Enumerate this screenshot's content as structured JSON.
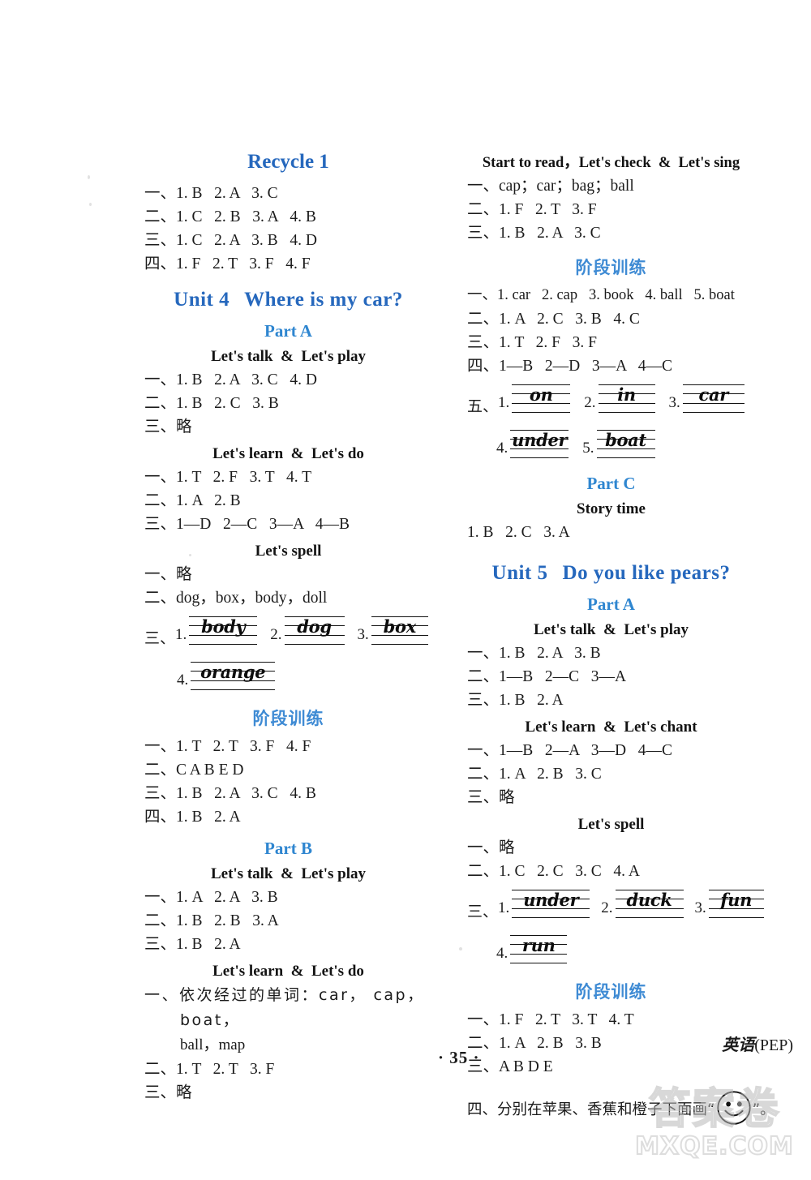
{
  "page": {
    "number": "· 35 ·",
    "book_label_cn": "英语",
    "book_label_en": "(PEP)"
  },
  "watermark": {
    "cn": "答案卷",
    "en": "MXQE.COM"
  },
  "left_column": {
    "recycle_heading": "Recycle 1",
    "recycle_answers": [
      "一、1. B   2. A   3. C",
      "二、1. C   2. B   3. A   4. B",
      "三、1. C   2. A   3. B   4. D",
      "四、1. F   2. T   3. F   4. F"
    ],
    "unit_label": "Unit 4",
    "unit_title": "Where is my car?",
    "part_a": "Part A",
    "sec_talk_play": "Let's talk  &  Let's play",
    "talk_play_answers": [
      "一、1. B   2. A   3. C   4. D",
      "二、1. B   2. C   3. B",
      "三、略"
    ],
    "sec_learn_do": "Let's learn  &  Let's do",
    "learn_do_answers": [
      "一、1. T   2. F   3. T   4. T",
      "二、1. A   2. B",
      "三、1—D   2—C   3—A   4—B"
    ],
    "sec_spell": "Let's spell",
    "spell_answers": [
      "一、略",
      "二、dog，box，body，doll"
    ],
    "spell_handwriting_label": "三、",
    "spell_handwriting": [
      {
        "num": "1.",
        "word": "body"
      },
      {
        "num": "2.",
        "word": "dog"
      },
      {
        "num": "3.",
        "word": "box"
      },
      {
        "num": "4.",
        "word": "orange"
      }
    ],
    "stage_training": "阶段训练",
    "stage_answers": [
      "一、1. T   2. T   3. F   4. F",
      "二、C A B E D",
      "三、1. B   2. A   3. C   4. B",
      "四、1. B   2. A"
    ],
    "part_b": "Part B",
    "b_talk_play": "Let's talk  &  Let's play",
    "b_talk_play_answers": [
      "一、1. A   2. A   3. B",
      "二、1. B   2. B   3. A",
      "三、1. B   2. A"
    ],
    "b_learn_do": "Let's learn  &  Let's do",
    "b_learn_do_line1": "一、依次经过的单词：car，  cap， boat，",
    "b_learn_do_line1_cont": "ball，map",
    "b_learn_do_answers": [
      "二、1. T   2. T   3. F",
      "三、略"
    ]
  },
  "right_column": {
    "sec_start_read": "Start to read，Let's check  &  Let's sing",
    "start_read_answers": [
      "一、cap；car；bag；ball",
      "二、1. F   2. T   3. F",
      "三、1. B   2. A   3. C"
    ],
    "stage_training": "阶段训练",
    "stage_answers": [
      "一、1. car   2. cap   3. book   4. ball   5. boat",
      "二、1. A   2. C   3. B   4. C",
      "三、1. T   2. F   3. F",
      "四、1—B   2—D   3—A   4—C"
    ],
    "stage_handwriting_label": "五、",
    "stage_handwriting": [
      {
        "num": "1.",
        "word": "on"
      },
      {
        "num": "2.",
        "word": "in"
      },
      {
        "num": "3.",
        "word": "car"
      },
      {
        "num": "4.",
        "word": "under"
      },
      {
        "num": "5.",
        "word": "boat"
      }
    ],
    "part_c": "Part C",
    "story_time": "Story time",
    "story_answers": [
      "1. B   2. C   3. A"
    ],
    "unit_label": "Unit 5",
    "unit_title": "Do you like pears?",
    "part_a": "Part A",
    "sec_talk_play": "Let's talk  &  Let's play",
    "talk_play_answers": [
      "一、1. B   2. A   3. B",
      "二、1—B   2—C   3—A",
      "三、1. B   2. A"
    ],
    "sec_learn_chant": "Let's learn  &  Let's chant",
    "learn_chant_answers": [
      "一、1—B   2—A   3—D   4—C",
      "二、1. A   2. B   3. C",
      "三、略"
    ],
    "sec_spell": "Let's spell",
    "spell_answers": [
      "一、略",
      "二、1. C   2. C   3. C   4. A"
    ],
    "spell_handwriting_label": "三、",
    "spell_handwriting": [
      {
        "num": "1.",
        "word": "under"
      },
      {
        "num": "2.",
        "word": "duck"
      },
      {
        "num": "3.",
        "word": "fun"
      },
      {
        "num": "4.",
        "word": "run"
      }
    ],
    "stage2_training": "阶段训练",
    "stage2_answers": [
      "一、1. F   2. T   3. T   4. T",
      "二、1. A   2. B   3. B",
      "三、A B D E"
    ],
    "stage2_last_prefix": "四、分别在苹果、香蕉和橙子下面画“",
    "stage2_last_suffix": "”。"
  }
}
